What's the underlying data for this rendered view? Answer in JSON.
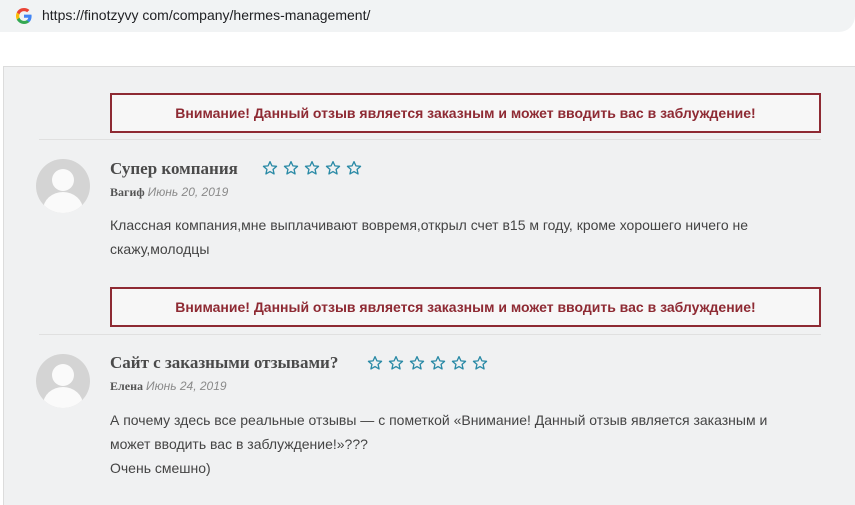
{
  "browser": {
    "url": "https://finotzyvy com/company/hermes-management/"
  },
  "icons": {
    "favicon": "google-g-icon",
    "avatar": "user-avatar-icon",
    "star": "star-outline-icon"
  },
  "colors": {
    "warning": "#8e2a33",
    "star": "#2a8aa6",
    "page_bg": "#f0f1f2"
  },
  "reviews": [
    {
      "warning": "Внимание! Данный отзыв является заказным и может вводить вас в заблуждение!",
      "title": "Супер компания",
      "rating": 0,
      "author": "Вагиф",
      "date": "Июнь 20, 2019",
      "text": [
        "Классная компания,мне выплачивают вовремя,открыл счет в15 м году, кроме хорошего ничего не",
        "скажу,молодцы"
      ]
    },
    {
      "warning": "Внимание! Данный отзыв является заказным и может вводить вас в заблуждение!",
      "title": "Сайт с заказными отзывами?",
      "rating": 0,
      "author": "Елена",
      "date": "Июнь 24, 2019",
      "text": [
        "А почему здесь все реальные отзывы — с пометкой «Внимание! Данный отзыв является заказным и",
        "может вводить вас в заблуждение!»???",
        "Очень смешно)"
      ]
    }
  ]
}
